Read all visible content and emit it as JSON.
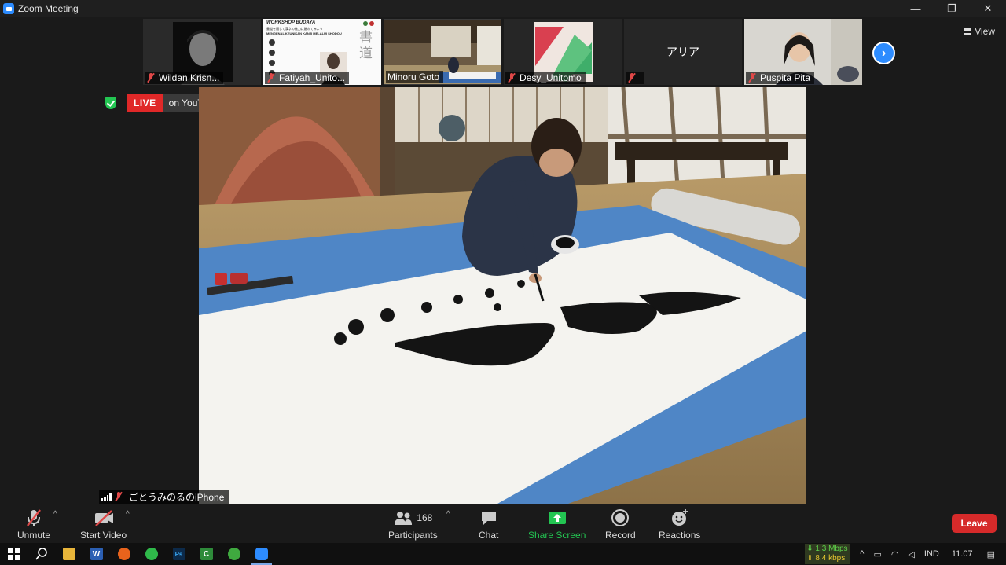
{
  "window": {
    "title": "Zoom Meeting",
    "controls": [
      "—",
      "❐",
      "✕"
    ]
  },
  "participants_strip": [
    {
      "name": "Wildan Krisn...",
      "muted": true
    },
    {
      "name": "Fatiyah_Unito...",
      "muted": true,
      "slide": {
        "heading": "WORKSHOP BUDAYA",
        "sub_jp": "書道を通して漢字の魅力に触れてみよう",
        "subtitle": "MENGENAL KEUNIKAN KANJI MELALUI SHODOU",
        "kanji": "書道"
      }
    },
    {
      "name": "Minoru Goto",
      "muted": false
    },
    {
      "name": "Desy_Unitomo",
      "muted": true
    },
    {
      "name": "",
      "display_text": "アリア",
      "muted": true
    },
    {
      "name": "Puspita Pita",
      "muted": true
    }
  ],
  "view": {
    "label": "View"
  },
  "live": {
    "badge": "LIVE",
    "platform": "on YouTube"
  },
  "active_speaker": {
    "label": "ごとうみのるのiPhone"
  },
  "toolbar": {
    "unmute": "Unmute",
    "start_video": "Start Video",
    "participants": "Participants",
    "participants_count": "168",
    "chat": "Chat",
    "share_screen": "Share Screen",
    "record": "Record",
    "reactions": "Reactions",
    "leave": "Leave"
  },
  "taskbar": {
    "apps": [
      "windows-start",
      "search",
      "file-explorer",
      "word",
      "firefox",
      "whatsapp",
      "photoshop",
      "camtasia",
      "chrome-like",
      "zoom"
    ],
    "net_down": "⬇ 1,3 Mbps",
    "net_up": "⬆ 8,4 kbps",
    "lang": "IND",
    "time": "11.07"
  },
  "colors": {
    "accent": "#2d8cff",
    "live": "#e02828",
    "share": "#23c552",
    "leave": "#d62a2a"
  }
}
